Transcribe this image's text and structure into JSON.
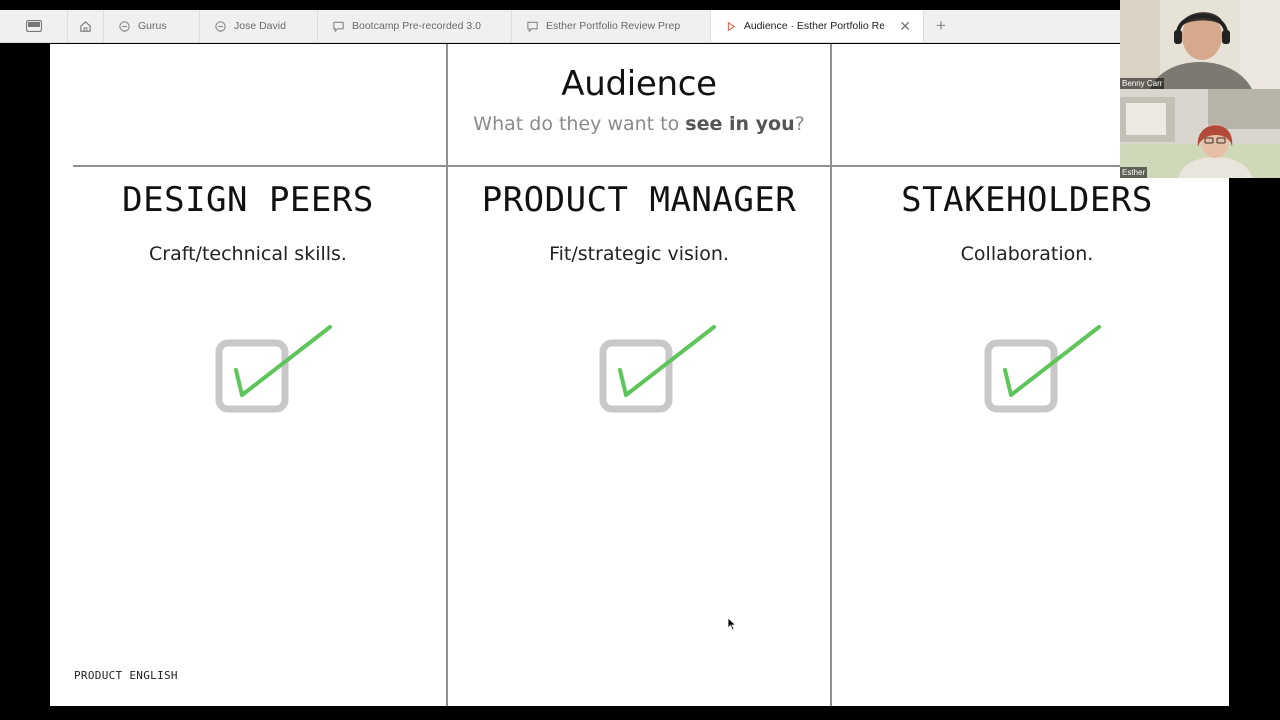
{
  "tabs": {
    "home_icon": "home-icon",
    "items": [
      {
        "label": "Gurus",
        "icon": "page-icon",
        "active": false
      },
      {
        "label": "Jose David",
        "icon": "page-icon",
        "active": false
      },
      {
        "label": "Bootcamp Pre-recorded 3.0",
        "icon": "comment-icon",
        "active": false
      },
      {
        "label": "Esther Portfolio Review Prep",
        "icon": "comment-icon",
        "active": false
      },
      {
        "label": "Audience · Esther Portfolio Revie",
        "icon": "play-icon",
        "active": true
      }
    ],
    "new_tab_label": "+",
    "close_label": "✕"
  },
  "slide": {
    "title": "Audience",
    "subtitle_pre": "What do they want to ",
    "subtitle_bold": "see in you",
    "subtitle_post": "?",
    "columns": [
      {
        "heading": "DESIGN PEERS",
        "description": "Craft/technical skills.",
        "checked": true
      },
      {
        "heading": "PRODUCT MANAGER",
        "description": "Fit/strategic vision.",
        "checked": true
      },
      {
        "heading": "STAKEHOLDERS",
        "description": "Collaboration.",
        "checked": true
      }
    ],
    "footer": "PRODUCT ENGLISH",
    "colors": {
      "check": "#5ec55a",
      "box": "#c8c8c8",
      "line": "#8f8f8f"
    }
  },
  "participants": [
    {
      "name": "Benny Carr"
    },
    {
      "name": "Esther"
    }
  ]
}
